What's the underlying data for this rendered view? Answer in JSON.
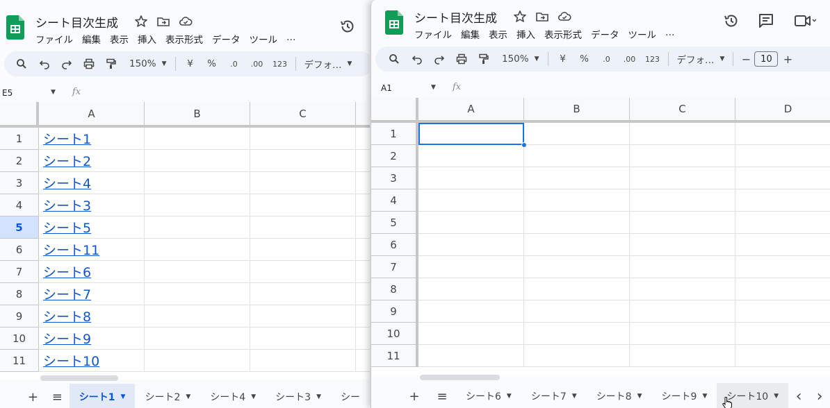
{
  "left": {
    "title": "シート目次生成",
    "menu": [
      "ファイル",
      "編集",
      "表示",
      "挿入",
      "表示形式",
      "データ",
      "ツール",
      "…"
    ],
    "toolbar": {
      "zoom": "150%",
      "currency": "¥",
      "percent": "%",
      "dec_less": ".0",
      "dec_more": ".00",
      "number_format": "123",
      "font": "デフォ…"
    },
    "namebox": "E5",
    "fx": "fx",
    "columns": [
      "A",
      "B",
      "C"
    ],
    "rows": [
      {
        "num": "1",
        "a": "シート1"
      },
      {
        "num": "2",
        "a": "シート2"
      },
      {
        "num": "3",
        "a": "シート4"
      },
      {
        "num": "4",
        "a": "シート3"
      },
      {
        "num": "5",
        "a": "シート5"
      },
      {
        "num": "6",
        "a": "シート11"
      },
      {
        "num": "7",
        "a": "シート6"
      },
      {
        "num": "8",
        "a": "シート7"
      },
      {
        "num": "9",
        "a": "シート8"
      },
      {
        "num": "10",
        "a": "シート9"
      },
      {
        "num": "11",
        "a": "シート10"
      }
    ],
    "active_row": "5",
    "tabs": {
      "add": "+",
      "list": "≡",
      "items": [
        "シート1",
        "シート2",
        "シート4",
        "シート3",
        "シー"
      ]
    }
  },
  "right": {
    "title": "シート目次生成",
    "menu": [
      "ファイル",
      "編集",
      "表示",
      "挿入",
      "表示形式",
      "データ",
      "ツール",
      "…"
    ],
    "toolbar": {
      "zoom": "150%",
      "currency": "¥",
      "percent": "%",
      "dec_less": ".0",
      "dec_more": ".00",
      "number_format": "123",
      "font": "デフォ…",
      "minus": "−",
      "font_size": "10",
      "plus": "+"
    },
    "namebox": "A1",
    "fx": "fx",
    "columns": [
      "A",
      "B",
      "C",
      "D"
    ],
    "rows": [
      "1",
      "2",
      "3",
      "4",
      "5",
      "6",
      "7",
      "8",
      "9",
      "10",
      "11"
    ],
    "tabs": {
      "add": "+",
      "list": "≡",
      "items": [
        "シート6",
        "シート7",
        "シート8",
        "シート9",
        "シート10"
      ],
      "prev": "‹",
      "next": "›"
    }
  },
  "colors": {
    "accent": "#1a73e8",
    "link": "#1155cc",
    "sheets_green": "#0f9d58",
    "toolbar_bg": "#edf2fa",
    "active_tab_bg": "#e1e9f7"
  }
}
